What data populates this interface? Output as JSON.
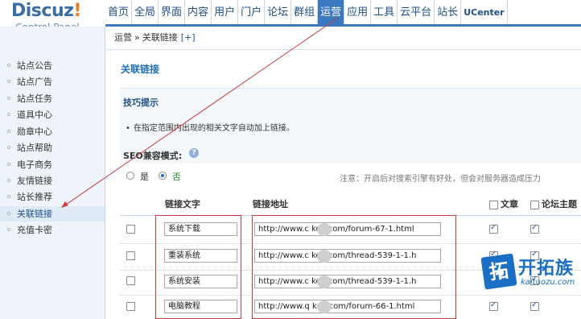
{
  "logo": {
    "title": "Discuz",
    "exclaim": "!",
    "subtitle": "Control Panel"
  },
  "topnav": [
    "首页",
    "全局",
    "界面",
    "内容",
    "用户",
    "门户",
    "论坛",
    "群组",
    "运营",
    "应用",
    "工具",
    "云平台",
    "站长",
    "UCenter"
  ],
  "topnav_active": "运营",
  "sidebar": [
    "站点公告",
    "站点广告",
    "站点任务",
    "道具中心",
    "勋章中心",
    "站点帮助",
    "电子商务",
    "友情链接",
    "站长推荐",
    "关联链接",
    "充值卡密"
  ],
  "sidebar_active": "关联链接",
  "breadcrumb": {
    "parent": "运营",
    "sep": "»",
    "current": "关联链接",
    "add": "[+]"
  },
  "page_title": "关联链接",
  "tips": {
    "title": "技巧提示",
    "bullet": "•",
    "text": "在指定范围内出现的相关文字自动加上链接。"
  },
  "seo": {
    "label": "SEO兼容模式:",
    "help": "?",
    "options": [
      "是",
      "否"
    ],
    "selected": "否",
    "notice": "注意：开启后对搜索引擎有好处，但会对服务器造成压力"
  },
  "table": {
    "headers": {
      "text": "链接文字",
      "url": "链接地址",
      "article": "文章",
      "forum": "论坛主题"
    },
    "rows": [
      {
        "text": "系统下载",
        "url": "http://www.c     koo.com/forum-67-1.html",
        "article": true,
        "forum": true
      },
      {
        "text": "重装系统",
        "url": "http://www.c     koo.com/thread-539-1-1.h",
        "article": true,
        "forum": true
      },
      {
        "text": "系统安装",
        "url": "http://www.c     koo.com/thread-539-1-1.h",
        "article": true,
        "forum": true
      },
      {
        "text": "电脑教程",
        "url": "http://www.q     koo.com/forum-66-1.html",
        "article": true,
        "forum": true
      }
    ]
  },
  "watermark": {
    "badge": "拓",
    "text": "开拓族",
    "domain": "kaituozu.com"
  },
  "colors": {
    "accent": "#3a78c0",
    "annotation": "#c8393e",
    "link": "#1f6fb5"
  }
}
